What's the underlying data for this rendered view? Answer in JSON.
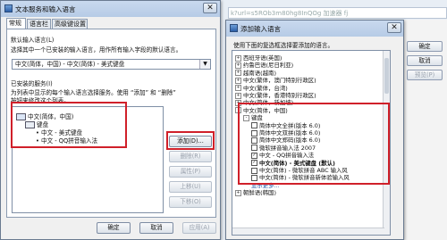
{
  "background": {
    "url_text": "k?url=s5ROb3m80hg8InQOg  加速器  fj"
  },
  "dialog1": {
    "title": "文本服务和输入语言",
    "close_glyph": "✕",
    "tabs": [
      "常规",
      "语言栏",
      "高级键设置"
    ],
    "default_lang_heading": "默认输入语言(L)",
    "default_lang_desc": "选择其中一个已安装的输入语言，用作所有输入字段的默认语言。",
    "default_lang_value": "中文(简体，中国) - 中文(简体) - 美式键盘",
    "installed_heading": "已安装的服务(I)",
    "installed_desc1": "为列表中显示的每个输入语言选择服务。使用 “添加” 和 “删除”",
    "installed_desc2": "按钮来修改这个列表。",
    "tree": {
      "root": "中文(简体，中国)",
      "group": "键盘",
      "items": [
        "中文 - 美式键盘",
        "中文 - QQ拼音输入法"
      ]
    },
    "side_buttons": {
      "add": "添加(D)...",
      "remove": "删除(R)",
      "properties": "属性(P)",
      "up": "上移(U)",
      "down": "下移(O)"
    },
    "bottom_buttons": {
      "ok": "确定",
      "cancel": "取消",
      "apply": "应用(A)"
    }
  },
  "dialog2": {
    "title": "添加输入语言",
    "close_glyph": "✕",
    "instruction": "使用下面的复选框选择要添加的语言。",
    "tree_items": [
      {
        "text": "西班牙语(英国)",
        "exp": "+",
        "level": 0
      },
      {
        "text": "约鲁巴语(尼日利亚)",
        "exp": "+",
        "level": 0
      },
      {
        "text": "越南语(越南)",
        "exp": "+",
        "level": 0
      },
      {
        "text": "中文(繁体，澳门特别行政区)",
        "exp": "+",
        "level": 0
      },
      {
        "text": "中文(繁体，台湾)",
        "exp": "+",
        "level": 0
      },
      {
        "text": "中文(繁体，香港特别行政区)",
        "exp": "+",
        "level": 0
      },
      {
        "text": "中文(简体，新加坡)",
        "exp": "+",
        "level": 0
      },
      {
        "text": "中文(简体，中国)",
        "exp": "-",
        "level": 0
      },
      {
        "text": "键盘",
        "exp": "-",
        "level": 1
      },
      {
        "text": "简体中文全拼(版本 6.0)",
        "chk": "",
        "level": 2
      },
      {
        "text": "简体中文双拼(版本 6.0)",
        "chk": "",
        "level": 2
      },
      {
        "text": "简体中文郑码(版本 6.0)",
        "chk": "",
        "level": 2
      },
      {
        "text": "微软拼音输入法 2007",
        "chk": "",
        "level": 2
      },
      {
        "text": "中文 - QQ拼音输入法",
        "chk": "✓",
        "level": 2
      },
      {
        "text": "中文(简体) - 美式键盘 (默认)",
        "chk": "✓",
        "level": 2,
        "bold": true
      },
      {
        "text": "中文(简体) - 微软拼音 ABC 输入风",
        "chk": "",
        "level": 2
      },
      {
        "text": "中文(简体) - 微软拼音新体验输入风",
        "chk": "",
        "level": 2
      },
      {
        "text": "显示更多...",
        "level": 2,
        "link": true
      },
      {
        "text": "朝鲜语(韩国)",
        "exp": "+",
        "level": 0
      }
    ],
    "buttons": {
      "ok": "确定",
      "cancel": "取消",
      "preview": "预览(P)"
    }
  }
}
